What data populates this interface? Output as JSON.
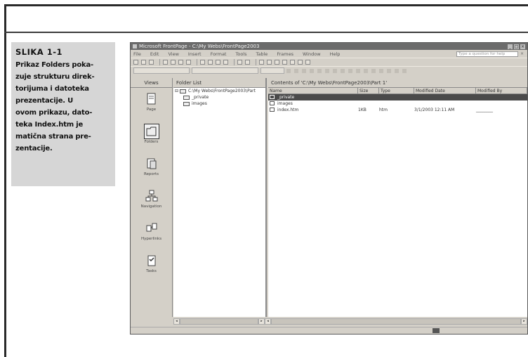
{
  "caption": {
    "title": "SLIKA 1-1",
    "body": "Prikaz Folders poka-\nzuje strukturu direk-\ntorijuma i datoteka\nprezentacije. U\novom prikazu, dato-\nteka Index.htm je\nmatična strana pre-\nzentacije."
  },
  "window": {
    "title": "Microsoft FrontPage - C:\\My Webs\\FrontPage2003",
    "menu": [
      "File",
      "Edit",
      "View",
      "Insert",
      "Format",
      "Tools",
      "Table",
      "Frames",
      "Window",
      "Help"
    ],
    "help_placeholder": "Type a question for help",
    "views_header": "Views",
    "views": [
      {
        "label": "Page",
        "icon": "page-view-icon"
      },
      {
        "label": "Folders",
        "icon": "folders-view-icon"
      },
      {
        "label": "Reports",
        "icon": "reports-view-icon"
      },
      {
        "label": "Navigation",
        "icon": "navigation-view-icon"
      },
      {
        "label": "Hyperlinks",
        "icon": "hyperlinks-view-icon"
      },
      {
        "label": "Tasks",
        "icon": "tasks-view-icon"
      }
    ],
    "folder_list_header": "Folder List",
    "tree": {
      "root": "C:\\My Webs\\FrontPage2003\\Part",
      "children": [
        "_private",
        "images"
      ]
    },
    "contents_header": "Contents of 'C:\\My Webs\\FrontPage2003\\Part 1'",
    "columns": [
      "Name",
      "Size",
      "Type",
      "Modified Date",
      "Modified By"
    ],
    "files": [
      {
        "name": "_private",
        "size": "",
        "type": "",
        "modified": "",
        "by": "",
        "selected": true
      },
      {
        "name": "images",
        "size": "",
        "type": "",
        "modified": "",
        "by": "",
        "selected": false
      },
      {
        "name": "index.htm",
        "size": "1KB",
        "type": "htm",
        "modified": "3/1/2003 12:11 AM",
        "by": "________",
        "selected": false
      }
    ]
  }
}
